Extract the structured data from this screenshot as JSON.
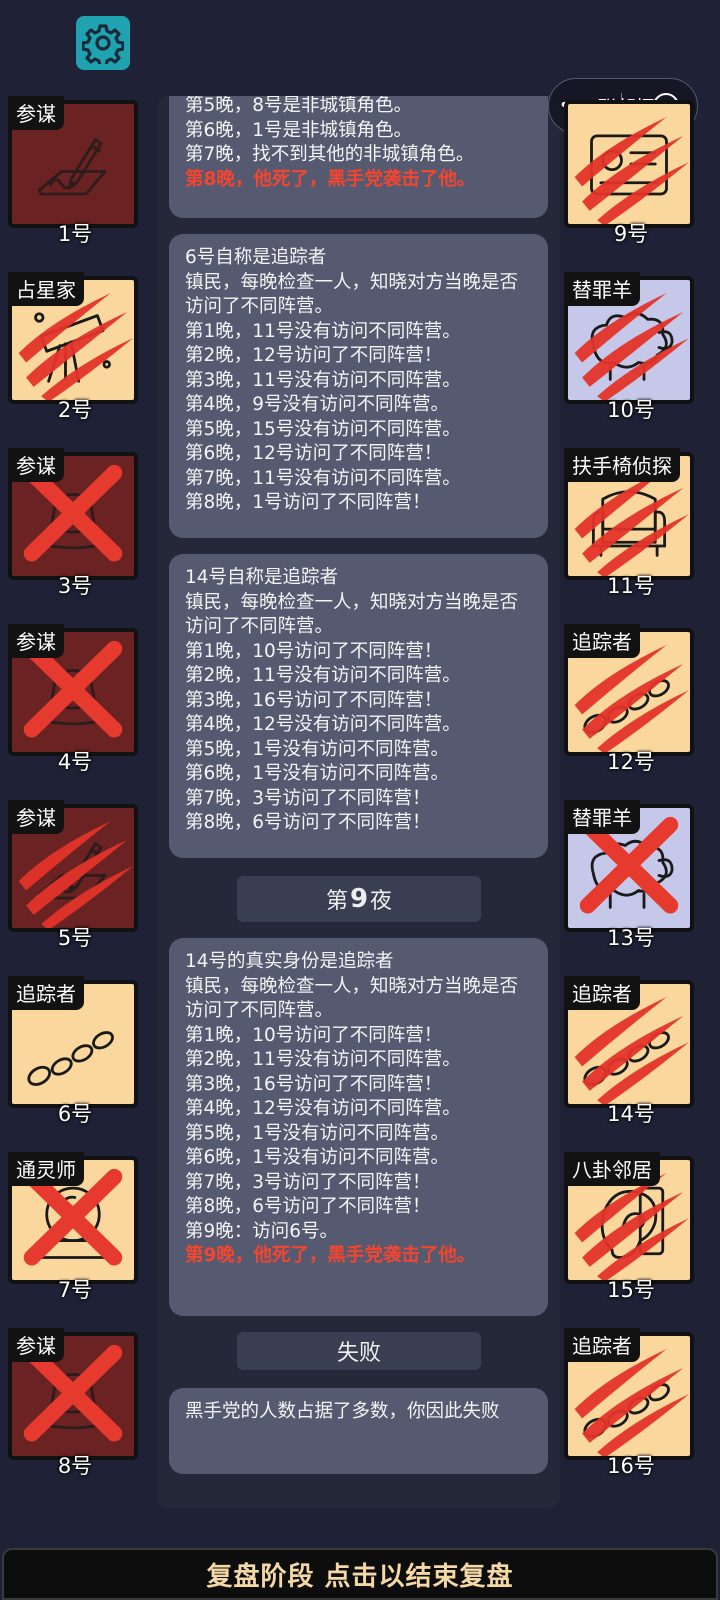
{
  "capsule": {
    "label": "联邦探"
  },
  "log": {
    "msg1": {
      "lines": [
        "第5晚，8号是非城镇角色。",
        "第6晚，1号是非城镇角色。",
        "第7晚，找不到其他的非城镇角色。"
      ],
      "red": "第8晚，他死了，黑手党袭击了他。"
    },
    "msg2": {
      "lines": [
        "6号自称是追踪者",
        "镇民，每晚检查一人，知晓对方当晚是否访问了不同阵营。",
        "第1晚，11号没有访问不同阵营。",
        "第2晚，12号访问了不同阵营！",
        "第3晚，11号没有访问不同阵营。",
        "第4晚，9号没有访问不同阵营。",
        "第5晚，15号没有访问不同阵营。",
        "第6晚，12号访问了不同阵营！",
        "第7晚，11号没有访问不同阵营。",
        "第8晚，1号访问了不同阵营！"
      ]
    },
    "msg3": {
      "lines": [
        "14号自称是追踪者",
        "镇民，每晚检查一人，知晓对方当晚是否访问了不同阵营。",
        "第1晚，10号访问了不同阵营！",
        "第2晚，11号没有访问不同阵营。",
        "第3晚，16号访问了不同阵营！",
        "第4晚，12号没有访问不同阵营。",
        "第5晚，1号没有访问不同阵营。",
        "第6晚，1号没有访问不同阵营。",
        "第7晚，3号访问了不同阵营！",
        "第8晚，6号访问了不同阵营！"
      ]
    },
    "night9": {
      "prefix": "第",
      "num": "9",
      "suffix": "夜"
    },
    "msg4": {
      "lines": [
        "14号的真实身份是追踪者",
        "镇民，每晚检查一人，知晓对方当晚是否访问了不同阵营。",
        "第1晚，10号访问了不同阵营！",
        "第2晚，11号没有访问不同阵营。",
        "第3晚，16号访问了不同阵营！",
        "第4晚，12号没有访问不同阵营。",
        "第5晚，1号没有访问不同阵营。",
        "第6晚，1号没有访问不同阵营。",
        "第7晚，3号访问了不同阵营！",
        "第8晚，6号访问了不同阵营！",
        "第9晚：访问6号。"
      ],
      "red": "第9晚，他死了，黑手党袭击了他。"
    },
    "fail_label": "失败",
    "msg5": {
      "lines": [
        "黑手党的人数占据了多数，你因此失败"
      ]
    }
  },
  "players": [
    {
      "role": "参谋",
      "num": "1号",
      "bg": "#6b2223",
      "icon": "signature-icon",
      "mark": "none"
    },
    {
      "role": "占星家",
      "num": "2号",
      "bg": "#f9d79d",
      "icon": "telescope-icon",
      "mark": "claw"
    },
    {
      "role": "参谋",
      "num": "3号",
      "bg": "#6b2223",
      "icon": "hat-icon",
      "mark": "cross"
    },
    {
      "role": "参谋",
      "num": "4号",
      "bg": "#6b2223",
      "icon": "hat-icon",
      "mark": "cross"
    },
    {
      "role": "参谋",
      "num": "5号",
      "bg": "#6b2223",
      "icon": "signature-icon",
      "mark": "claw"
    },
    {
      "role": "追踪者",
      "num": "6号",
      "bg": "#f9d79d",
      "icon": "footprints-icon",
      "mark": "none"
    },
    {
      "role": "通灵师",
      "num": "7号",
      "bg": "#f9d79d",
      "icon": "crystal-ball-icon",
      "mark": "cross"
    },
    {
      "role": "参谋",
      "num": "8号",
      "bg": "#6b2223",
      "icon": "hat-icon",
      "mark": "cross"
    },
    {
      "role": "",
      "num": "9号",
      "bg": "#f9d79d",
      "icon": "badge-icon",
      "mark": "claw"
    },
    {
      "role": "替罪羊",
      "num": "10号",
      "bg": "#c6c8ea",
      "icon": "sheep-icon",
      "mark": "claw"
    },
    {
      "role": "扶手椅侦探",
      "num": "11号",
      "bg": "#f9d79d",
      "icon": "armchair-icon",
      "mark": "claw"
    },
    {
      "role": "追踪者",
      "num": "12号",
      "bg": "#f9d79d",
      "icon": "footprints-icon",
      "mark": "claw"
    },
    {
      "role": "替罪羊",
      "num": "13号",
      "bg": "#c6c8ea",
      "icon": "sheep-icon",
      "mark": "cross"
    },
    {
      "role": "追踪者",
      "num": "14号",
      "bg": "#f9d79d",
      "icon": "footprints-icon",
      "mark": "claw"
    },
    {
      "role": "八卦邻居",
      "num": "15号",
      "bg": "#f9d79d",
      "icon": "ear-icon",
      "mark": "claw"
    },
    {
      "role": "追踪者",
      "num": "16号",
      "bg": "#f9d79d",
      "icon": "footprints-icon",
      "mark": "claw"
    }
  ],
  "bottom": {
    "label": "复盘阶段 点击以结束复盘"
  },
  "colors": {
    "accent": "#1fa3b1",
    "red": "#f4452f",
    "panel": "#555a70"
  }
}
